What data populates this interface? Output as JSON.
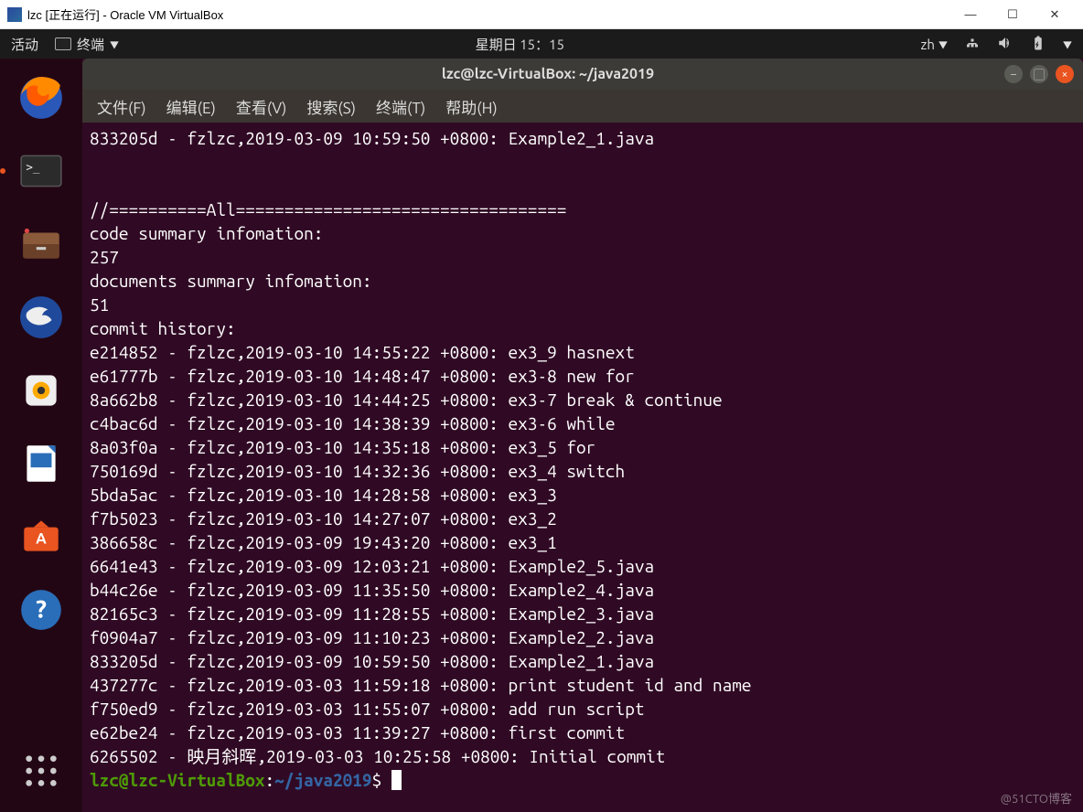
{
  "vbox": {
    "title": "lzc [正在运行] - Oracle VM VirtualBox",
    "min": "—",
    "max": "☐",
    "close": "✕"
  },
  "gnome": {
    "activities": "活动",
    "appname": "终端",
    "clock": "星期日 15：15",
    "lang": "zh"
  },
  "term": {
    "title": "lzc@lzc-VirtualBox: ~/java2019",
    "menu": {
      "file": "文件(F)",
      "edit": "编辑(E)",
      "view": "查看(V)",
      "search": "搜索(S)",
      "terminal": "终端(T)",
      "help": "帮助(H)"
    },
    "prompt_user": "lzc@lzc-VirtualBox",
    "prompt_sep": ":",
    "prompt_path": "~/java2019",
    "prompt_end": "$",
    "lines": [
      "833205d - fzlzc,2019-03-09 10:59:50 +0800: Example2_1.java",
      "",
      "",
      "//==========All==================================",
      "code summary infomation:",
      "257",
      "documents summary infomation:",
      "51",
      "commit history:",
      "e214852 - fzlzc,2019-03-10 14:55:22 +0800: ex3_9 hasnext",
      "e61777b - fzlzc,2019-03-10 14:48:47 +0800: ex3-8 new for",
      "8a662b8 - fzlzc,2019-03-10 14:44:25 +0800: ex3-7 break & continue",
      "c4bac6d - fzlzc,2019-03-10 14:38:39 +0800: ex3-6 while",
      "8a03f0a - fzlzc,2019-03-10 14:35:18 +0800: ex3_5 for",
      "750169d - fzlzc,2019-03-10 14:32:36 +0800: ex3_4 switch",
      "5bda5ac - fzlzc,2019-03-10 14:28:58 +0800: ex3_3",
      "f7b5023 - fzlzc,2019-03-10 14:27:07 +0800: ex3_2",
      "386658c - fzlzc,2019-03-09 19:43:20 +0800: ex3_1",
      "6641e43 - fzlzc,2019-03-09 12:03:21 +0800: Example2_5.java",
      "b44c26e - fzlzc,2019-03-09 11:35:50 +0800: Example2_4.java",
      "82165c3 - fzlzc,2019-03-09 11:28:55 +0800: Example2_3.java",
      "f0904a7 - fzlzc,2019-03-09 11:10:23 +0800: Example2_2.java",
      "833205d - fzlzc,2019-03-09 10:59:50 +0800: Example2_1.java",
      "437277c - fzlzc,2019-03-03 11:59:18 +0800: print student id and name",
      "f750ed9 - fzlzc,2019-03-03 11:55:07 +0800: add run script",
      "e62be24 - fzlzc,2019-03-03 11:39:27 +0800: first commit",
      "6265502 - 映月斜晖,2019-03-03 10:25:58 +0800: Initial commit"
    ]
  },
  "watermark": "@51CTO博客"
}
